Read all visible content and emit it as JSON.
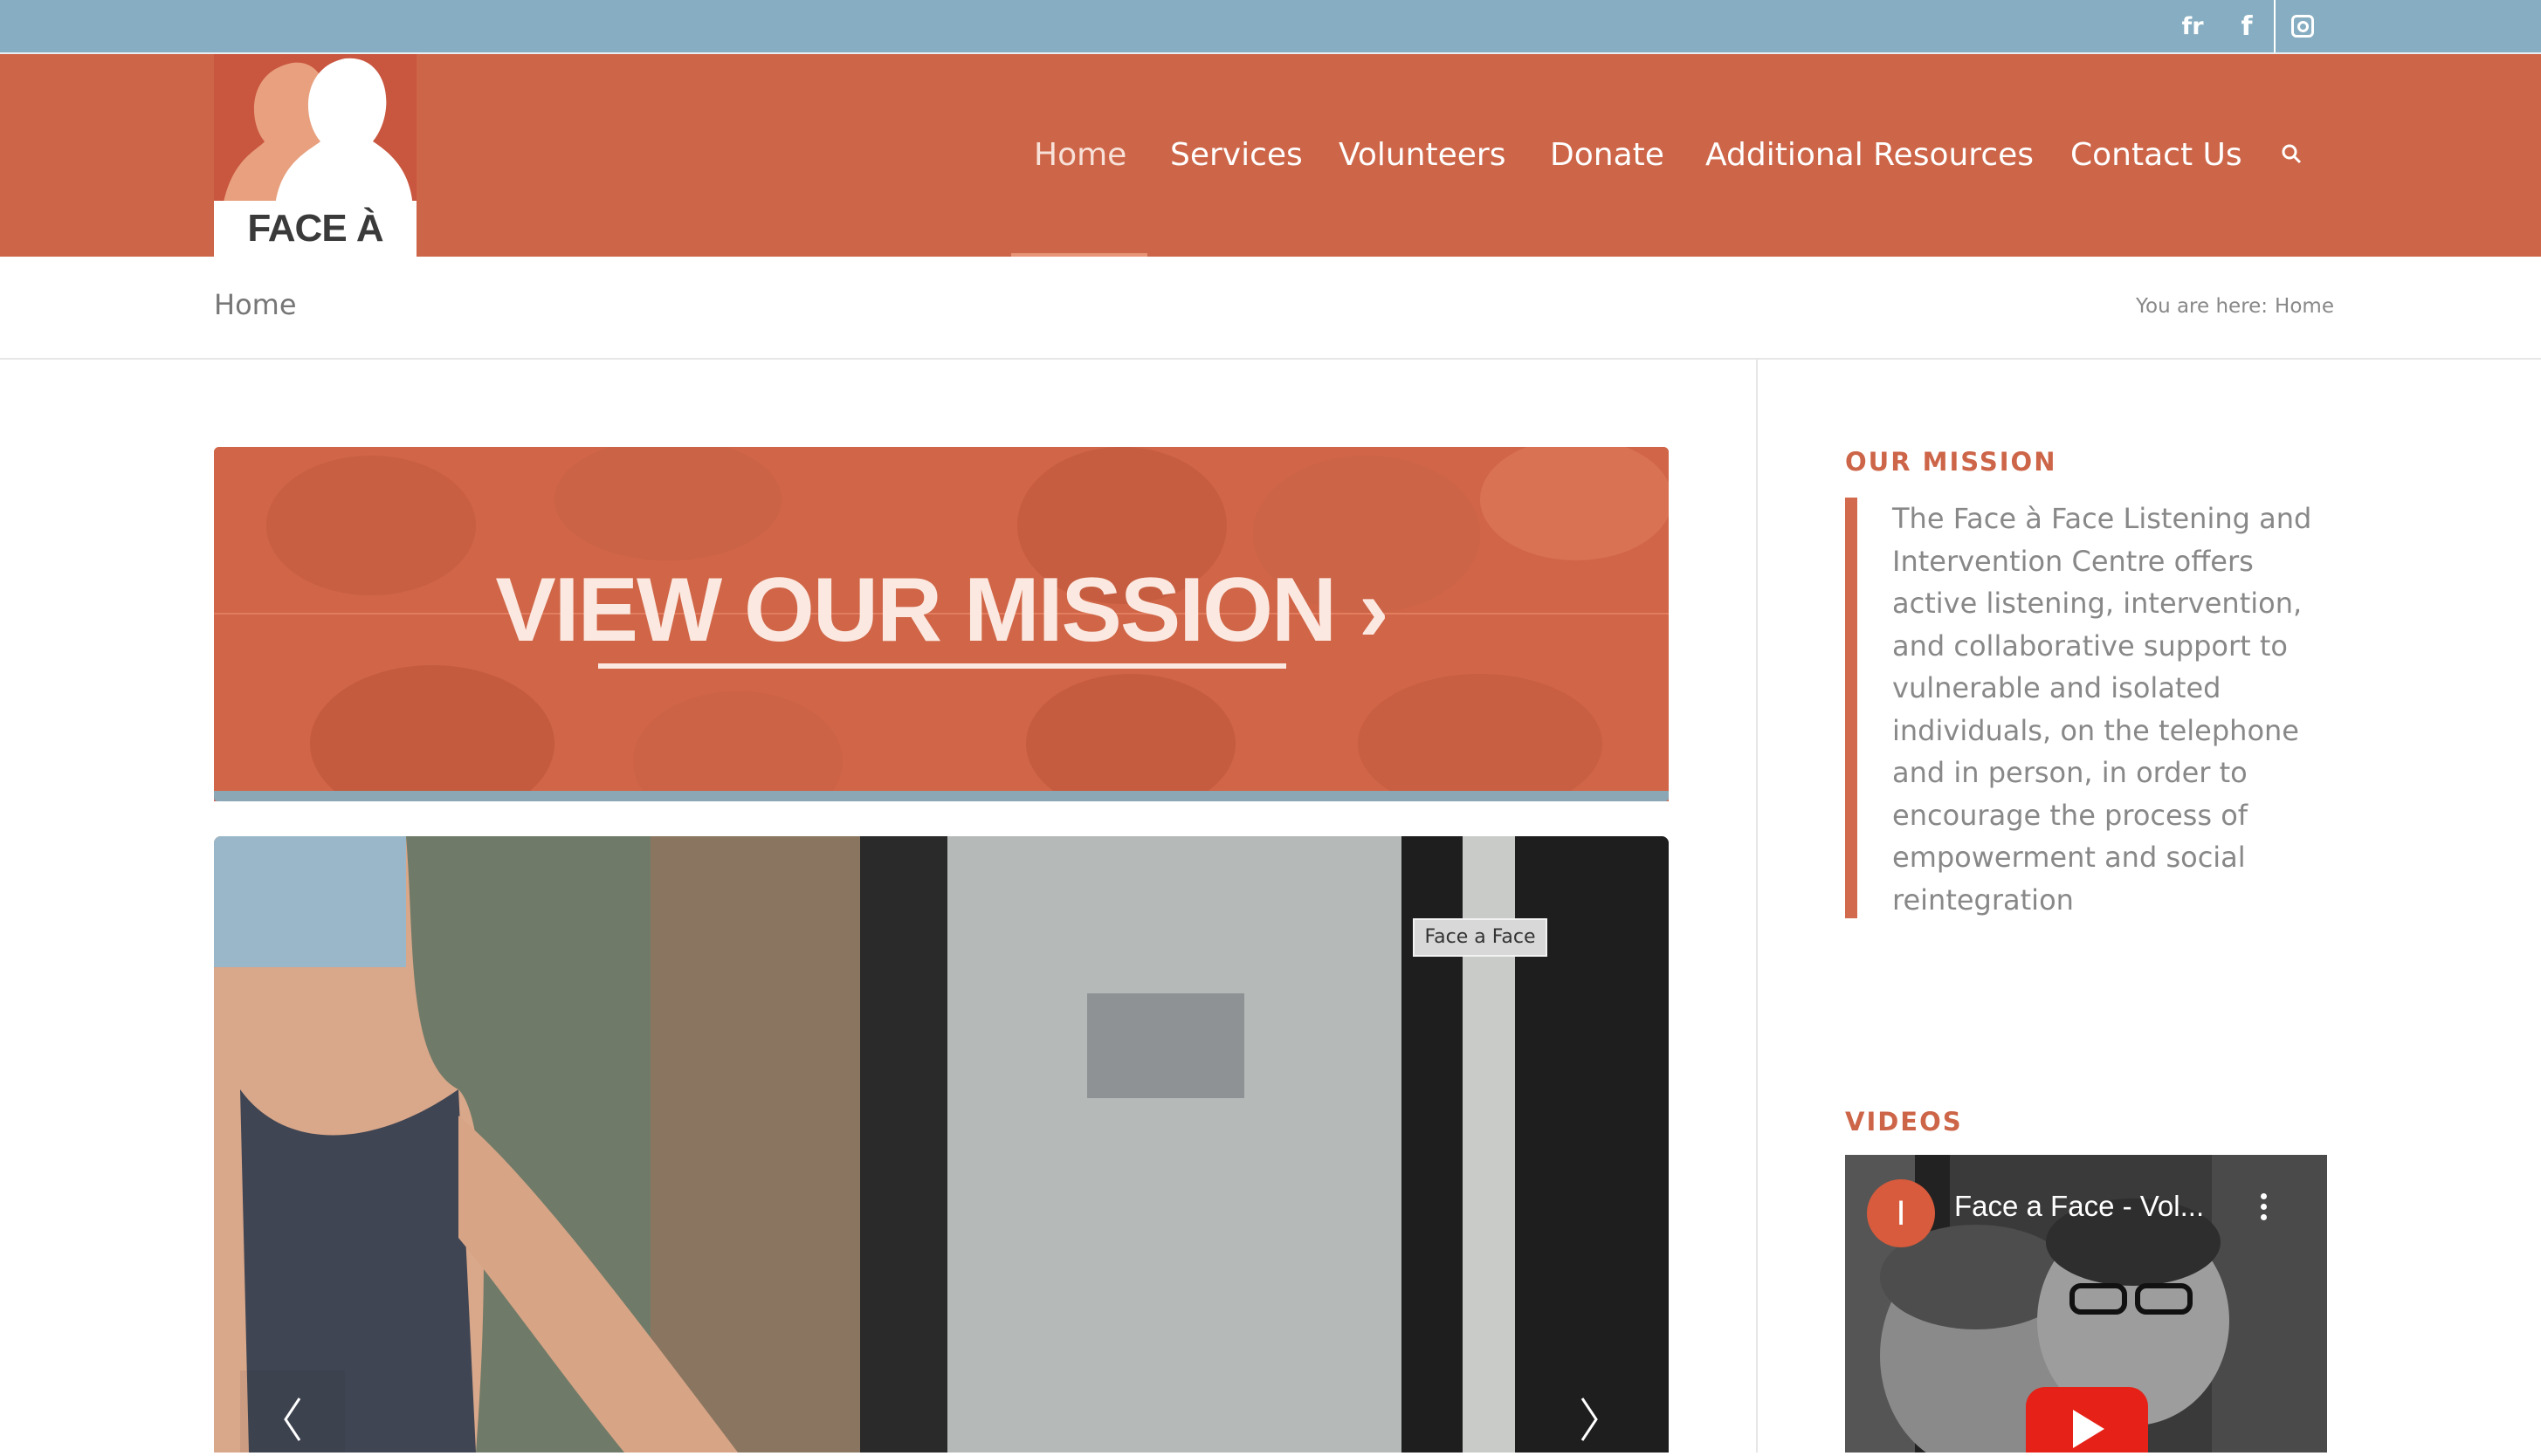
{
  "social": {
    "lang_label": "fr",
    "facebook_icon": "facebook-icon",
    "instagram_icon": "instagram-icon"
  },
  "logo": {
    "text": "FACE À FACE"
  },
  "nav": {
    "items": [
      {
        "label": "Home",
        "active": true
      },
      {
        "label": "Services"
      },
      {
        "label": "Volunteers"
      },
      {
        "label": "Donate"
      },
      {
        "label": "Additional Resources"
      },
      {
        "label": "Contact Us"
      }
    ],
    "search_icon": "search-icon"
  },
  "page": {
    "title": "Home",
    "breadcrumb_prefix": "You are here:",
    "breadcrumb_current": "Home"
  },
  "banner": {
    "text": "VIEW OUR MISSION ›"
  },
  "slider": {
    "caption": "Face a Face"
  },
  "sidebar": {
    "mission_title": "OUR MISSION",
    "mission_text": "The Face à Face Listening and Intervention Centre offers active listening, intervention, and collaborative support to vulnerable and isolated individuals, on the telephone and in person, in order to encourage  the process of empowerment and social reintegration",
    "videos_title": "VIDEOS",
    "video": {
      "avatar_letter": "I",
      "title": "Face a Face - Vol..."
    }
  },
  "colors": {
    "topbar": "#86adc1",
    "brand": "#cd6548",
    "accent_strip": "#8ba6b5"
  }
}
